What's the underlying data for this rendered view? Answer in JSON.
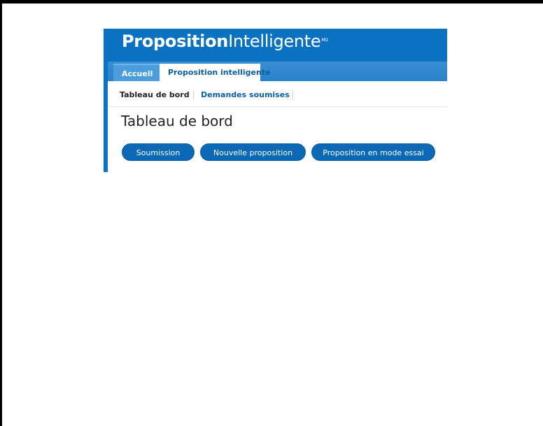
{
  "logo": {
    "bold": "Proposition",
    "thin": "Intelligente",
    "mark": "MD"
  },
  "tabs": [
    {
      "label": "Accueil"
    },
    {
      "label": "Proposition intelligente"
    }
  ],
  "subnav": [
    {
      "label": "Tableau de bord"
    },
    {
      "label": "Demandes soumises"
    }
  ],
  "page": {
    "title": "Tableau de bord"
  },
  "actions": [
    {
      "label": "Soumission"
    },
    {
      "label": "Nouvelle proposition"
    },
    {
      "label": "Proposition en mode essai"
    }
  ],
  "colors": {
    "brand_blue": "#0a72c0",
    "button_blue": "#0a68b4",
    "link_blue": "#0a5fa8"
  }
}
